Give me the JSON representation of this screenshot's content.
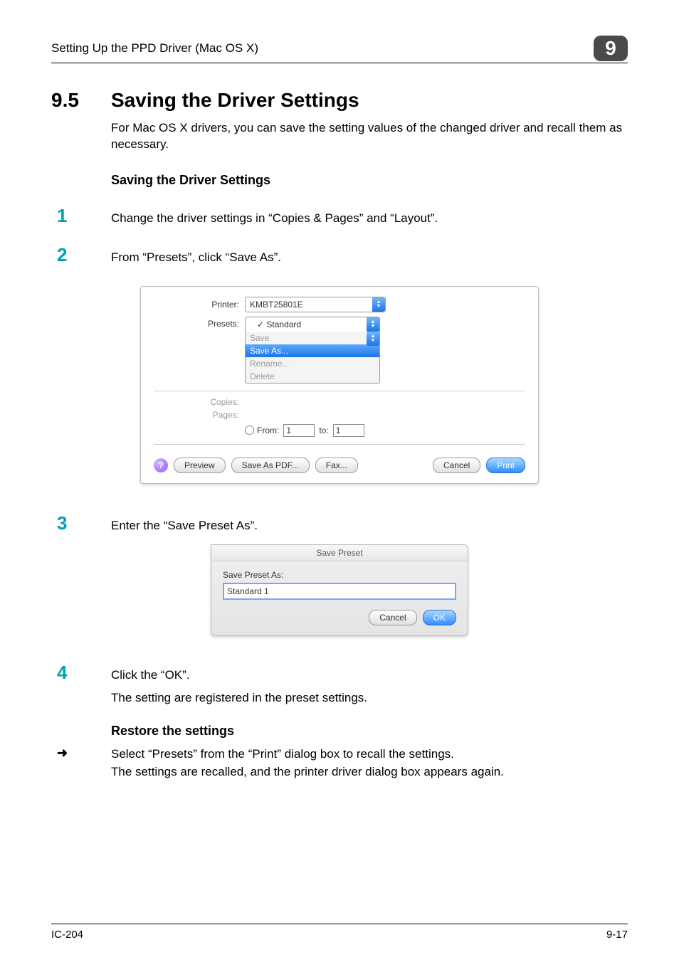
{
  "header": {
    "left": "Setting Up the PPD Driver (Mac OS X)",
    "chapter": "9"
  },
  "section": {
    "number": "9.5",
    "title": "Saving the Driver Settings"
  },
  "intro": "For Mac OS X drivers, you can save the setting values of the changed driver and recall them as necessary.",
  "subhead1": "Saving the Driver Settings",
  "steps": {
    "s1": "Change the driver settings in “Copies & Pages” and “Layout”.",
    "s2": "From “Presets”, click “Save As”.",
    "s3": "Enter the “Save Preset As”.",
    "s4": "Click the “OK”.",
    "s4_after": "The setting are registered in the preset settings."
  },
  "dialog1": {
    "printer_label": "Printer:",
    "printer_value": "KMBT25801E",
    "presets_label": "Presets:",
    "presets_selected": "✓ Standard",
    "menu": {
      "save": "Save",
      "save_as": "Save As...",
      "rename": "Rename...",
      "delete": "Delete"
    },
    "copies_label": "Copies:",
    "pages_label": "Pages:",
    "from_label": "From:",
    "from_value": "1",
    "to_label": "to:",
    "to_value": "1",
    "buttons": {
      "preview": "Preview",
      "save_as_pdf": "Save As PDF...",
      "fax": "Fax...",
      "cancel": "Cancel",
      "print": "Print"
    },
    "help": "?"
  },
  "dialog2": {
    "title": "Save Preset",
    "label": "Save Preset As:",
    "value": "Standard 1",
    "cancel": "Cancel",
    "ok": "OK"
  },
  "restore": {
    "heading": "Restore the settings",
    "arrow": "➜",
    "line1": "Select “Presets” from the “Print” dialog box to recall the settings.",
    "line2": "The settings are recalled, and the printer driver dialog box appears again."
  },
  "footer": {
    "left": "IC-204",
    "right": "9-17"
  }
}
